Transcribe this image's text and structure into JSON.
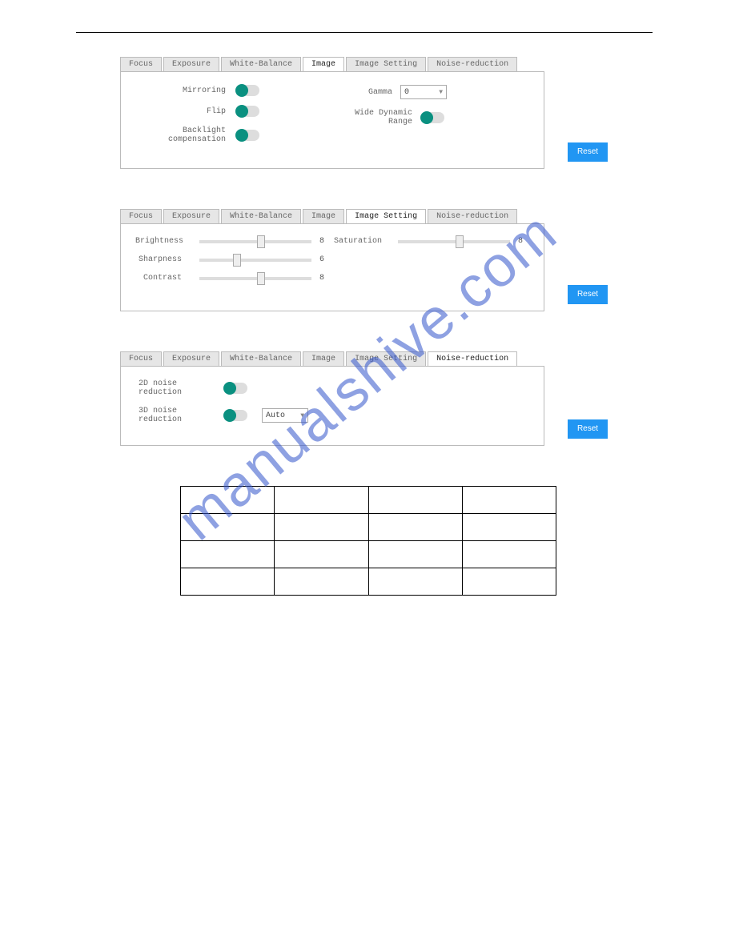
{
  "tabs": [
    "Focus",
    "Exposure",
    "White-Balance",
    "Image",
    "Image Setting",
    "Noise-reduction"
  ],
  "panel1": {
    "active_tab": "Image",
    "mirror_label": "Mirroring",
    "flip_label": "Flip",
    "backlight_label": "Backlight compensation",
    "gamma_label": "Gamma",
    "gamma_value": "0",
    "wdr_label": "Wide Dynamic Range",
    "reset": "Reset"
  },
  "panel2": {
    "active_tab": "Image Setting",
    "brightness_label": "Brightness",
    "brightness_value": "8",
    "sharpness_label": "Sharpness",
    "sharpness_value": "6",
    "contrast_label": "Contrast",
    "contrast_value": "8",
    "saturation_label": "Saturation",
    "saturation_value": "8",
    "reset": "Reset"
  },
  "panel3": {
    "active_tab": "Noise-reduction",
    "nr2d_label": "2D noise reduction",
    "nr3d_label": "3D noise reduction",
    "nr3d_mode": "Auto",
    "reset": "Reset"
  },
  "watermark": "manualshive.com",
  "empty_table": {
    "rows": 4,
    "cols": 4
  }
}
